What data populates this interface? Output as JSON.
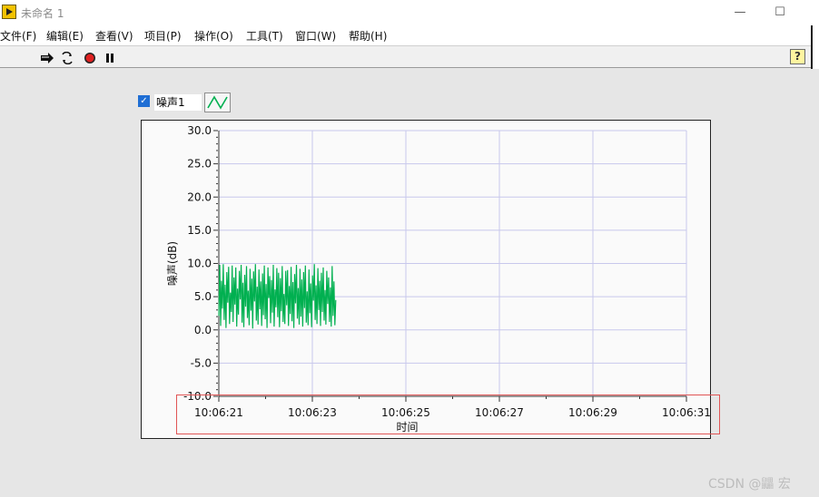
{
  "window": {
    "title": "未命名 1"
  },
  "menu": [
    "文件(F)",
    "编辑(E)",
    "查看(V)",
    "项目(P)",
    "操作(O)",
    "工具(T)",
    "窗口(W)",
    "帮助(H)"
  ],
  "toolbar": {
    "help_label": "?"
  },
  "legend": {
    "checked": true,
    "name": "噪声1"
  },
  "chart_data": {
    "type": "line",
    "ylabel": "噪声(dB)",
    "xlabel": "时间",
    "ylim": [
      -10.0,
      30.0
    ],
    "yticks": [
      "30.0",
      "25.0",
      "20.0",
      "15.0",
      "10.0",
      "5.0",
      "0.0",
      "-5.0",
      "-10.0"
    ],
    "xlim": [
      "10:06:21",
      "10:06:31"
    ],
    "xticks": [
      "10:06:21",
      "10:06:23",
      "10:06:25",
      "10:06:27",
      "10:06:29",
      "10:06:31"
    ],
    "grid": true,
    "series": [
      {
        "name": "噪声1",
        "color": "#00b050",
        "x_start": "10:06:21.0",
        "x_end": "10:06:23.5",
        "values": [
          2.1,
          9.8,
          0.6,
          7.4,
          3.2,
          9.9,
          1.5,
          6.8,
          0.3,
          8.7,
          4.1,
          9.5,
          0.9,
          5.6,
          2.7,
          9.7,
          1.2,
          7.9,
          3.8,
          9.4,
          0.5,
          6.2,
          2.3,
          8.9,
          4.6,
          9.8,
          1.1,
          7.1,
          0.4,
          8.3,
          3.5,
          9.6,
          1.8,
          5.9,
          0.7,
          9.2,
          2.9,
          7.7,
          0.2,
          8.8,
          4.3,
          9.9,
          1.4,
          6.5,
          0.8,
          9.1,
          3.1,
          7.3,
          0.6,
          8.5,
          2.2,
          9.7,
          1.6,
          6.9,
          0.3,
          9.4,
          4.8,
          8.1,
          1.0,
          7.5,
          2.6,
          9.8,
          0.5,
          6.1,
          3.4,
          9.3,
          1.9,
          8.6,
          0.4,
          7.8,
          2.8,
          9.6,
          1.2,
          5.4,
          0.9,
          8.9,
          3.7,
          9.0,
          0.6,
          6.6,
          2.4,
          9.5,
          1.3,
          7.2,
          0.3,
          8.4,
          4.0,
          9.8,
          1.7,
          6.3,
          0.8,
          9.2,
          2.0,
          7.6,
          0.5,
          8.7,
          3.3,
          9.7,
          1.1,
          5.8,
          0.7,
          9.1,
          2.5,
          7.0,
          0.4,
          8.2,
          4.4,
          9.9,
          1.5,
          6.7,
          0.9,
          9.3,
          3.0,
          7.4,
          0.6,
          8.6,
          2.7,
          9.4,
          1.4,
          6.0,
          0.8,
          8.9,
          3.9,
          7.9,
          1.2,
          6.4,
          0.5,
          9.6,
          2.1,
          7.3,
          0.7,
          4.5
        ]
      }
    ]
  },
  "watermark": "CSDN @鼺 宏"
}
